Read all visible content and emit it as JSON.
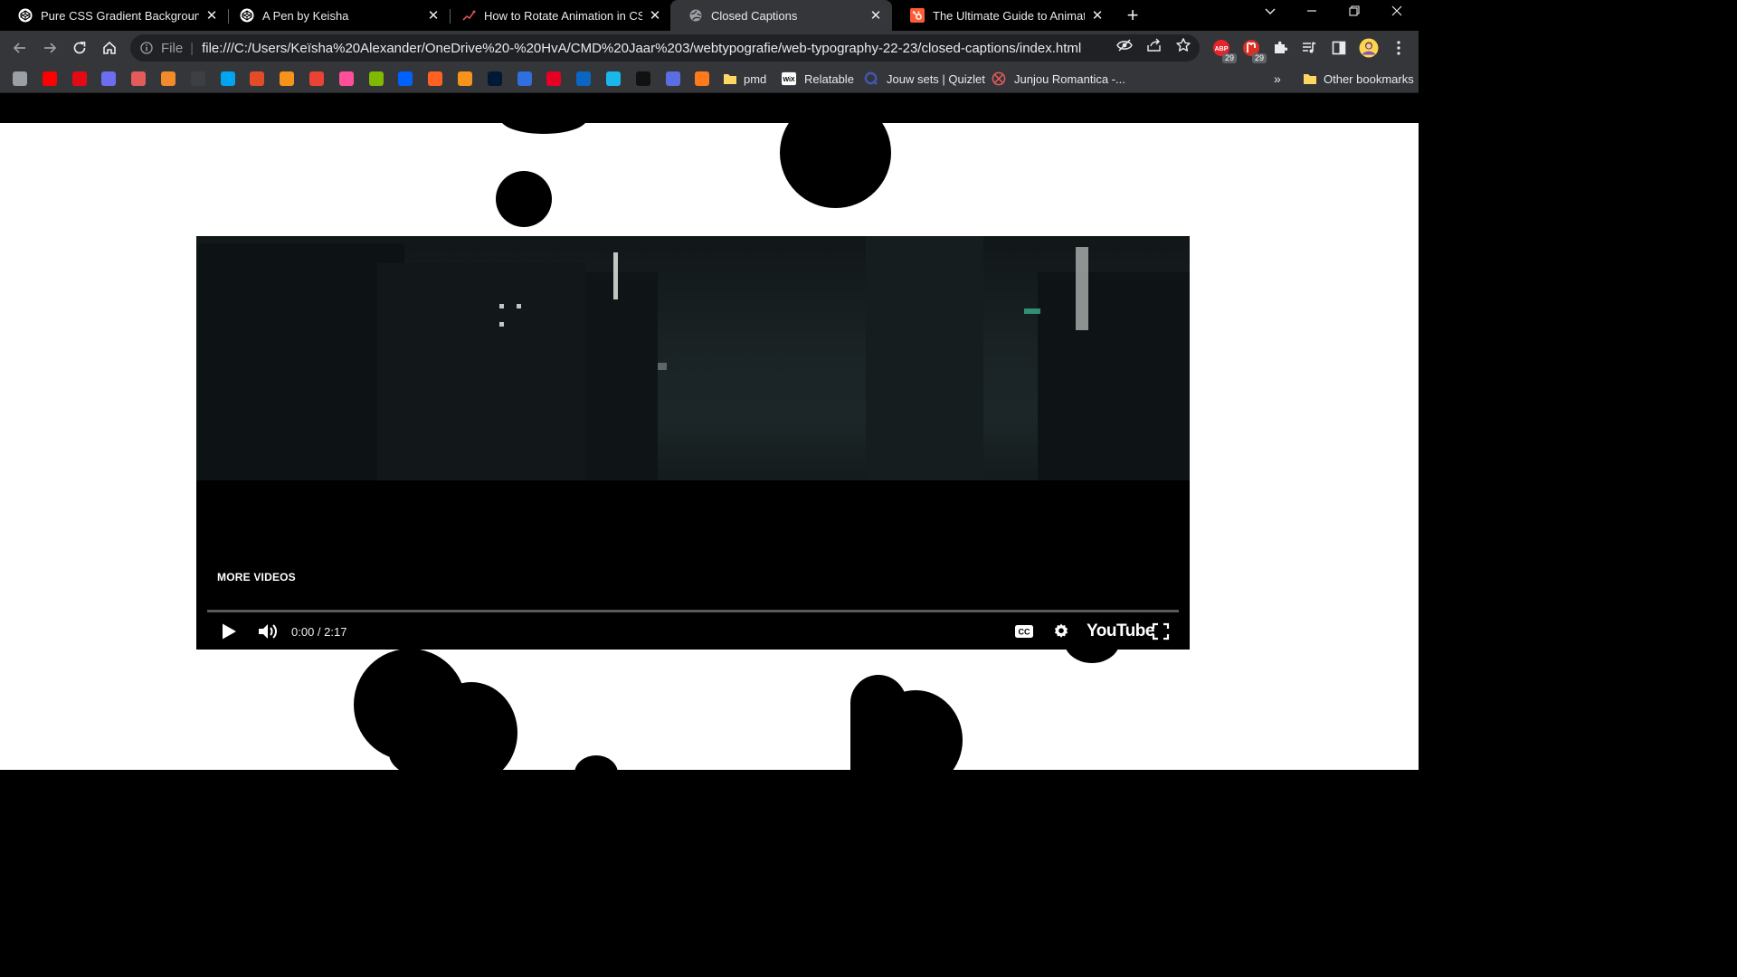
{
  "browser": {
    "tabs": [
      {
        "title": "Pure CSS Gradient Background A",
        "icon": "codepen-icon",
        "active": false
      },
      {
        "title": "A Pen by Keisha",
        "icon": "codepen-icon",
        "active": false
      },
      {
        "title": "How to Rotate Animation in CSS",
        "icon": "site-icon",
        "active": false
      },
      {
        "title": "Closed Captions",
        "icon": "globe-icon",
        "active": true
      },
      {
        "title": "The Ultimate Guide to Animation",
        "icon": "hubspot-icon",
        "active": false
      }
    ],
    "address": {
      "scheme": "File",
      "url": "file:///C:/Users/Keïsha%20Alexander/OneDrive%20-%20HvA/CMD%20Jaar%203/webtypografie/web-typography-22-23/closed-captions/index.html"
    },
    "extension_badges": [
      "29",
      "29"
    ],
    "bookmarks": {
      "icons": [
        {
          "name": "layers-bookmark-icon",
          "color": "#9aa0a6"
        },
        {
          "name": "youtube-bookmark-icon",
          "color": "#ff0000"
        },
        {
          "name": "netflix-bookmark-icon",
          "color": "#e50914"
        },
        {
          "name": "calendar-bookmark-icon",
          "color": "#6d6df2"
        },
        {
          "name": "anime-bookmark-icon",
          "color": "#e35b5b"
        },
        {
          "name": "puzzle-bookmark-icon",
          "color": "#f28b2a"
        },
        {
          "name": "wifi-bookmark-icon",
          "color": "#3c4043"
        },
        {
          "name": "microsoft-bookmark-icon",
          "color": "#00a4ef"
        },
        {
          "name": "c-bookmark-icon",
          "color": "#e34c26"
        },
        {
          "name": "bitcoin-bookmark-icon",
          "color": "#f7931a"
        },
        {
          "name": "gmail-bookmark-icon",
          "color": "#ea4335"
        },
        {
          "name": "flower-bookmark-icon",
          "color": "#ff4f9a"
        },
        {
          "name": "microsoft-bookmark-icon-2",
          "color": "#7fba00"
        },
        {
          "name": "dropbox-bookmark-icon",
          "color": "#0061ff"
        },
        {
          "name": "wattpad-bookmark-icon",
          "color": "#ff6122"
        },
        {
          "name": "bitcoin-bookmark-icon-2",
          "color": "#f7931a"
        },
        {
          "name": "tumblr-bookmark-icon",
          "color": "#001935"
        },
        {
          "name": "r-bookmark-icon",
          "color": "#2f6fde"
        },
        {
          "name": "pinterest-bookmark-icon",
          "color": "#e60023"
        },
        {
          "name": "linkedin-bookmark-icon",
          "color": "#0a66c2"
        },
        {
          "name": "vimeo-bookmark-icon",
          "color": "#1ab7ea"
        },
        {
          "name": "tiktok-bookmark-icon",
          "color": "#111111"
        },
        {
          "name": "counter-bookmark-icon",
          "color": "#5b6ee1"
        },
        {
          "name": "fire-bookmark-icon",
          "color": "#ff7a1a"
        }
      ],
      "labeled": [
        {
          "label": "pmd",
          "icon": "folder-icon"
        },
        {
          "label": "Relatable",
          "icon": "wix-icon"
        },
        {
          "label": "Jouw sets | Quizlet",
          "icon": "quizlet-icon"
        },
        {
          "label": "Junjou Romantica -...",
          "icon": "anime-icon"
        }
      ],
      "overflow": "»",
      "other": "Other bookmarks"
    }
  },
  "player": {
    "more_videos": "MORE VIDEOS",
    "time": "0:00 / 2:17",
    "progress": 0,
    "brand": "YouTube"
  },
  "colors": {
    "accent_red": "#ff0000",
    "tab_active_bg": "#35363a",
    "page_bg": "#ffffff"
  }
}
